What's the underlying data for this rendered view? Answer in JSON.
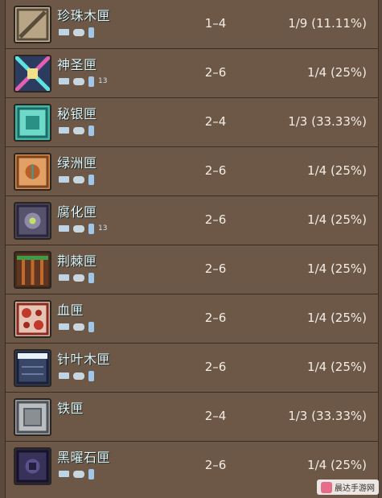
{
  "rows": [
    {
      "name": "珍珠木匣",
      "stack": "1–4",
      "chance": "1/9 (11.11%)",
      "icon": "pearlwood-crate-icon",
      "three_ds": ""
    },
    {
      "name": "神圣匣",
      "stack": "2–6",
      "chance": "1/4 (25%)",
      "icon": "hallowed-crate-icon",
      "three_ds": "13"
    },
    {
      "name": "秘银匣",
      "stack": "2–4",
      "chance": "1/3 (33.33%)",
      "icon": "mythril-crate-icon",
      "three_ds": ""
    },
    {
      "name": "绿洲匣",
      "stack": "2–6",
      "chance": "1/4 (25%)",
      "icon": "oasis-crate-icon",
      "three_ds": ""
    },
    {
      "name": "腐化匣",
      "stack": "2–6",
      "chance": "1/4 (25%)",
      "icon": "corrupt-crate-icon",
      "three_ds": "13"
    },
    {
      "name": "荆棘匣",
      "stack": "2–6",
      "chance": "1/4 (25%)",
      "icon": "bramble-crate-icon",
      "three_ds": ""
    },
    {
      "name": "血匣",
      "stack": "2–6",
      "chance": "1/4 (25%)",
      "icon": "blood-crate-icon",
      "three_ds": ""
    },
    {
      "name": "针叶木匣",
      "stack": "2–6",
      "chance": "1/4 (25%)",
      "icon": "boreal-crate-icon",
      "three_ds": ""
    },
    {
      "name": "铁匣",
      "stack": "2–4",
      "chance": "1/3 (33.33%)",
      "icon": "iron-crate-icon",
      "three_ds": ""
    },
    {
      "name": "黑曜石匣",
      "stack": "2–6",
      "chance": "1/4 (25%)",
      "icon": "obsidian-crate-icon",
      "three_ds": ""
    }
  ],
  "watermark": {
    "text": "晨达手游网"
  },
  "colors": {
    "row_bg": "#6d5847",
    "text": "#f2ece4",
    "name_text": "#e9f4f4",
    "divider": "#3a2e24"
  }
}
